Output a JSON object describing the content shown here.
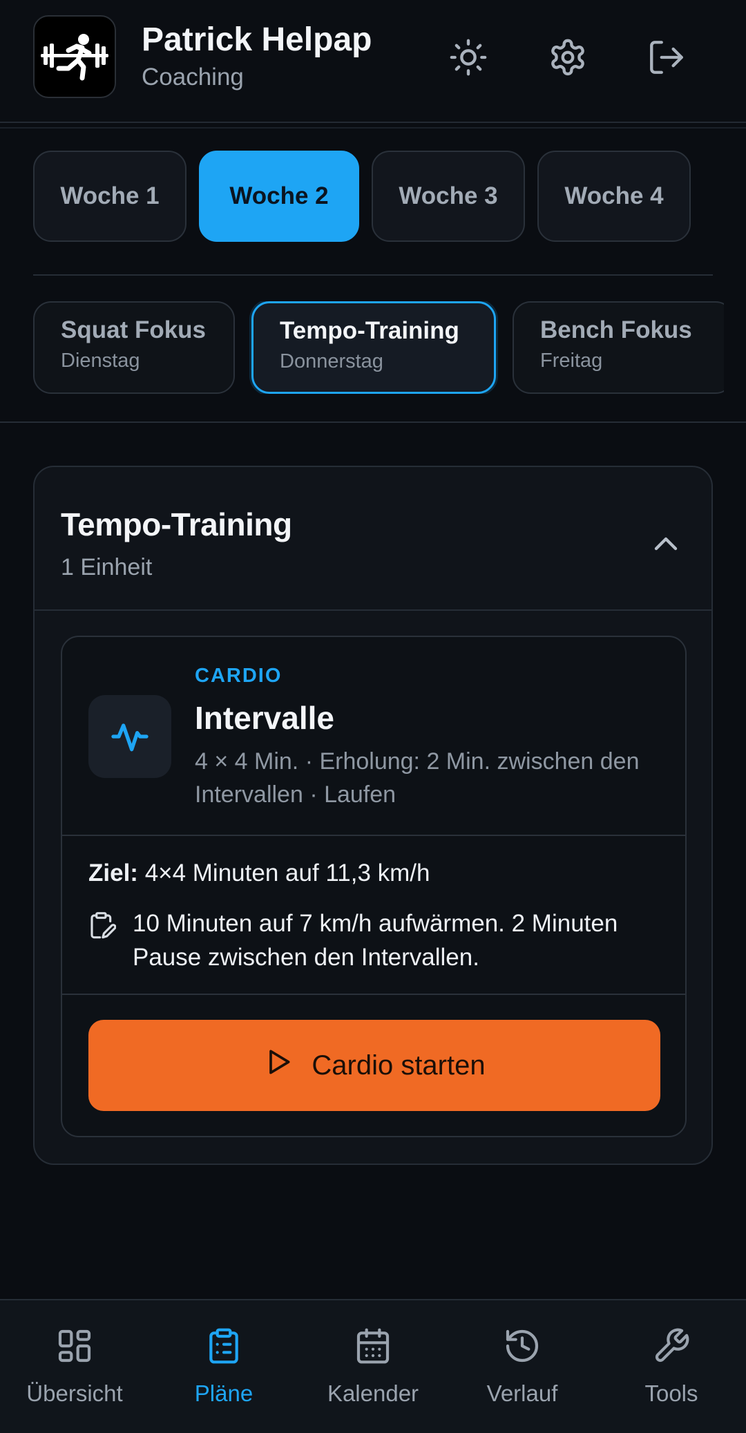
{
  "colors": {
    "accent": "#1ea5f4",
    "cta": "#f06a24",
    "background": "#0a0d12"
  },
  "header": {
    "title": "Patrick Helpap",
    "subtitle": "Coaching",
    "logo_icon": "athlete-running-icon",
    "actions": [
      {
        "icon": "sun-icon"
      },
      {
        "icon": "gear-icon"
      },
      {
        "icon": "logout-icon"
      }
    ]
  },
  "weeks": {
    "selected": "Woche 2",
    "items": [
      "Woche 1",
      "Woche 2",
      "Woche 3",
      "Woche 4"
    ]
  },
  "days": {
    "selected": "Tempo-Training",
    "items": [
      {
        "title": "Squat Fokus",
        "day": "Dienstag"
      },
      {
        "title": "Tempo-Training",
        "day": "Donnerstag"
      },
      {
        "title": "Bench Fokus",
        "day": "Freitag"
      }
    ]
  },
  "session": {
    "title": "Tempo-Training",
    "count": "1 Einheit",
    "unit": {
      "category": "CARDIO",
      "name": "Intervalle",
      "description": "4 × 4 Min. · Erholung: 2 Min. zwischen den Intervallen · Laufen",
      "goal_label": "Ziel:",
      "goal_value": "4×4 Minuten auf 11,3 km/h",
      "note": "10 Minuten auf 7 km/h aufwärmen. 2 Minuten Pause zwischen den Intervallen.",
      "start_label": "Cardio starten"
    }
  },
  "nav": {
    "selected": "Pläne",
    "items": [
      {
        "label": "Übersicht",
        "icon": "grid-icon"
      },
      {
        "label": "Pläne",
        "icon": "clipboard-list-icon"
      },
      {
        "label": "Kalender",
        "icon": "calendar-icon"
      },
      {
        "label": "Verlauf",
        "icon": "history-icon"
      },
      {
        "label": "Tools",
        "icon": "wrench-icon"
      }
    ]
  }
}
